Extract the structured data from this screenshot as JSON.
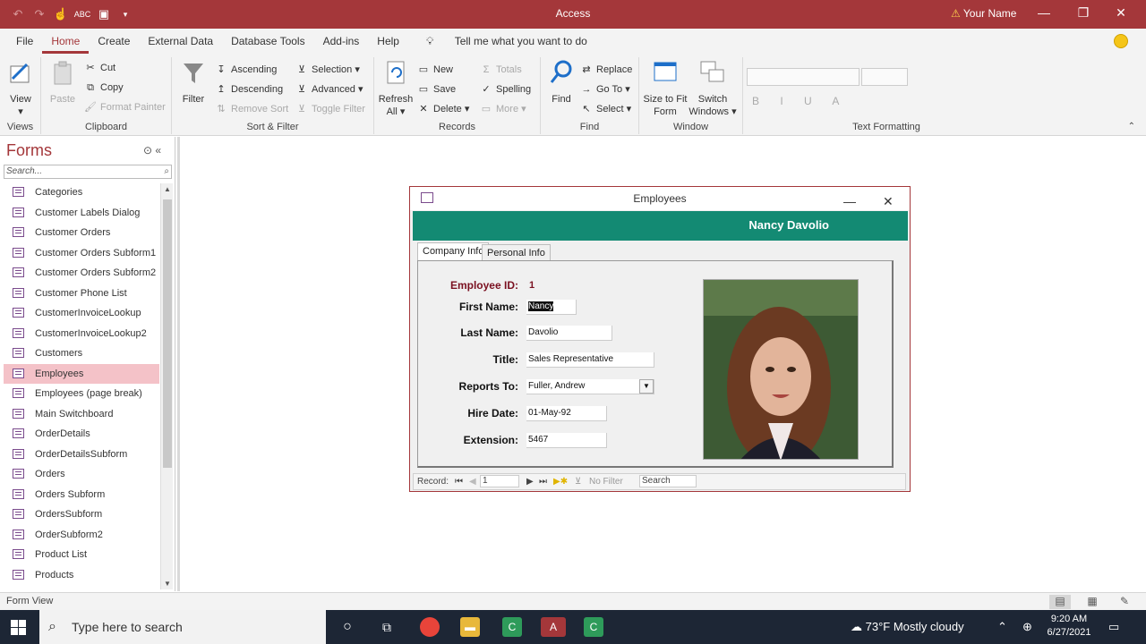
{
  "window": {
    "title": "Access",
    "user": "Your Name",
    "min": "—",
    "restore": "❐",
    "close": "✕"
  },
  "menu": {
    "items": [
      "File",
      "Home",
      "Create",
      "External Data",
      "Database Tools",
      "Add-ins",
      "Help"
    ],
    "tell": "Tell me what you want to do"
  },
  "ribbon": {
    "views": {
      "label": "Views",
      "view": "View"
    },
    "clipboard": {
      "label": "Clipboard",
      "paste": "Paste",
      "cut": "Cut",
      "copy": "Copy",
      "format_painter": "Format Painter"
    },
    "sortfilter": {
      "label": "Sort & Filter",
      "filter": "Filter",
      "ascending": "Ascending",
      "descending": "Descending",
      "remove_sort": "Remove Sort",
      "selection": "Selection",
      "advanced": "Advanced",
      "toggle_filter": "Toggle Filter"
    },
    "records": {
      "label": "Records",
      "refresh_all": "Refresh All",
      "new": "New",
      "save": "Save",
      "delete": "Delete",
      "totals": "Totals",
      "spelling": "Spelling",
      "more": "More"
    },
    "find": {
      "label": "Find",
      "find": "Find",
      "replace": "Replace",
      "go_to": "Go To",
      "select": "Select"
    },
    "window": {
      "label": "Window",
      "size_to_fit": "Size to Fit Form",
      "switch_windows": "Switch Windows"
    },
    "text_formatting": {
      "label": "Text Formatting"
    }
  },
  "nav": {
    "title": "Forms",
    "search_placeholder": "Search...",
    "items": [
      "Categories",
      "Customer Labels Dialog",
      "Customer Orders",
      "Customer Orders Subform1",
      "Customer Orders Subform2",
      "Customer Phone List",
      "CustomerInvoiceLookup",
      "CustomerInvoiceLookup2",
      "Customers",
      "Employees",
      "Employees (page break)",
      "Main Switchboard",
      "OrderDetails",
      "OrderDetailsSubform",
      "Orders",
      "Orders Subform",
      "OrdersSubform",
      "OrderSubform2",
      "Product List",
      "Products"
    ],
    "selected_index": 9
  },
  "form": {
    "title": "Employees",
    "header_name": "Nancy Davolio",
    "tabs": [
      "Company Info",
      "Personal Info"
    ],
    "labels": {
      "employee_id": "Employee ID:",
      "first_name": "First Name:",
      "last_name": "Last Name:",
      "title": "Title:",
      "reports_to": "Reports To:",
      "hire_date": "Hire Date:",
      "extension": "Extension:"
    },
    "values": {
      "employee_id": "1",
      "first_name": "Nancy",
      "last_name": "Davolio",
      "title": "Sales Representative",
      "reports_to": "Fuller, Andrew",
      "hire_date": "01-May-92",
      "extension": "5467"
    },
    "record_nav": {
      "label": "Record:",
      "current": "1",
      "filter": "No Filter",
      "search": "Search"
    }
  },
  "status": {
    "text": "Form View"
  },
  "taskbar": {
    "search": "Type here to search",
    "weather": "73°F  Mostly cloudy",
    "time": "9:20 AM",
    "date": "6/27/2021"
  },
  "colors": {
    "accent": "#a4373a",
    "header_band": "#138a73",
    "nav_selected": "#f4c2c8"
  }
}
